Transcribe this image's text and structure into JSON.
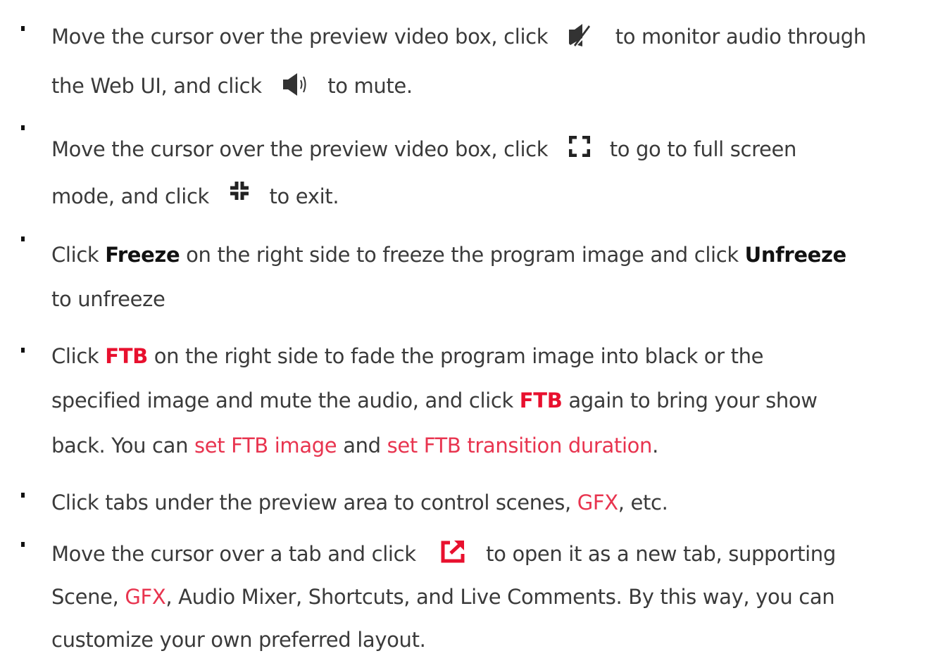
{
  "items": [
    {
      "lines": [
        [
          "Move the cursor over the preview video box, click",
          "to monitor audio through"
        ],
        [
          "the Web UI, and click",
          "to mute."
        ]
      ]
    },
    {
      "lines": [
        [
          "Move the cursor over the preview video box, click",
          "to go to full screen"
        ],
        [
          "mode, and click",
          "to exit."
        ]
      ]
    },
    {
      "lines": [
        [
          "Click",
          "Freeze",
          "on the right side to freeze the program image and click",
          "Unfreeze"
        ],
        [
          "to unfreeze"
        ]
      ]
    },
    {
      "lines": [
        [
          "Click",
          "FTB",
          "on the right side to fade the program image into black or the"
        ],
        [
          "specified image and mute the audio, and click",
          "FTB",
          "again to bring your show"
        ],
        [
          "back. You can",
          "set FTB image",
          "and",
          "set FTB transition duration",
          "."
        ]
      ]
    },
    {
      "lines": [
        [
          "Click tabs under the preview area to control scenes,",
          "GFX",
          ", etc."
        ]
      ]
    },
    {
      "lines": [
        [
          "Move the cursor over a tab and click",
          "to open it as a new tab, supporting"
        ],
        [
          "Scene,",
          "GFX",
          ", Audio Mixer, Shortcuts, and Live Comments. By this way, you can"
        ],
        [
          "customize your own preferred layout."
        ]
      ]
    }
  ],
  "icons": {
    "muted": "speaker-muted-icon",
    "unmuted": "speaker-unmuted-icon",
    "fullscreen": "fullscreen-enter-icon",
    "exit_fullscreen": "fullscreen-exit-icon",
    "open_new_tab": "open-new-tab-icon"
  },
  "colors": {
    "text": "#3a3a3a",
    "emphasis": "#111111",
    "accent_red": "#e8102e",
    "link_red": "#e8344f"
  }
}
